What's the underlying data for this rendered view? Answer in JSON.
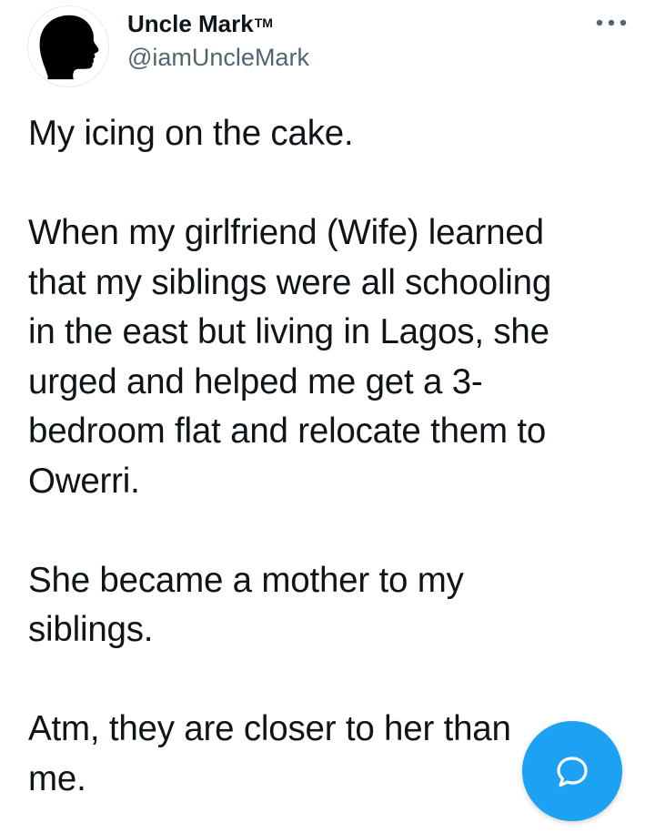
{
  "author": {
    "display_name": "Uncle Mark",
    "trademark": "TM",
    "handle": "@iamUncleMark",
    "avatar_icon": "silhouette-profile-icon"
  },
  "header": {
    "more_icon": "more-dots-icon"
  },
  "tweet": {
    "paragraphs": [
      "My icing on the cake.",
      "When my girlfriend (Wife) learned\nthat my siblings were all schooling\nin the east but living in Lagos, she\nurged and helped me get a 3-\nbedroom flat and relocate them to\nOwerri.",
      "She became a mother to my\nsiblings.",
      "Atm, they are closer to her than\nme."
    ]
  },
  "fab": {
    "icon": "reply-bubble-icon",
    "color": "#1da1f2"
  },
  "colors": {
    "text": "#0f1419",
    "secondary_text": "#536471",
    "accent": "#1da1f2",
    "background": "#ffffff"
  }
}
